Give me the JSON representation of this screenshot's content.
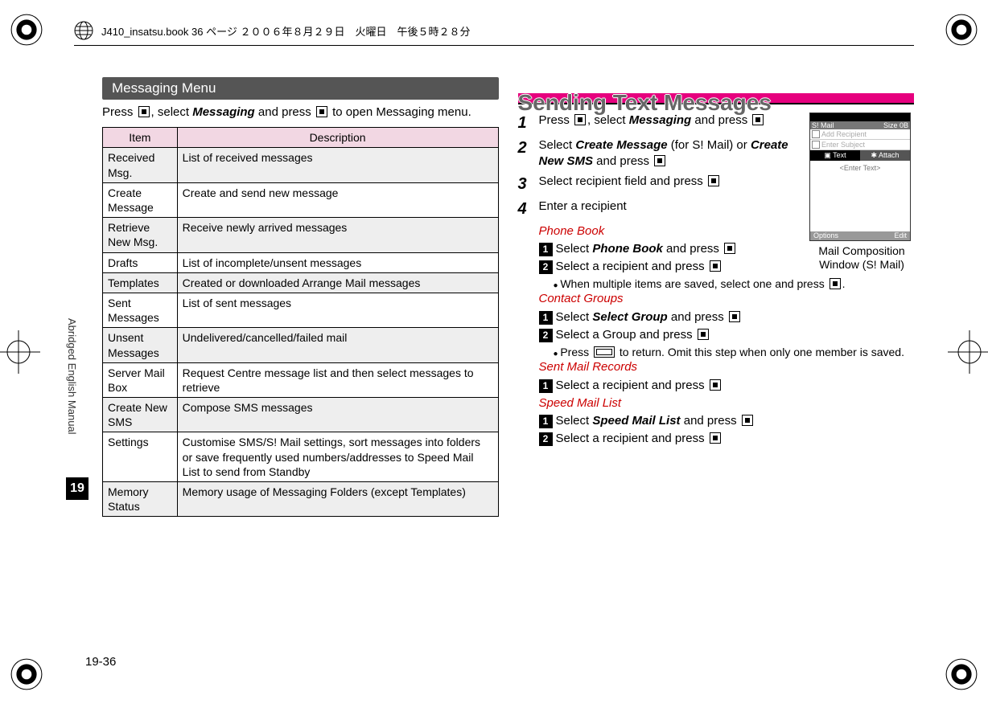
{
  "header_ts": "J410_insatsu.book 36 ページ ２００６年８月２９日　火曜日　午後５時２８分",
  "side_tab": "Abridged English Manual",
  "chapter": "19",
  "page_num": "19-36",
  "left": {
    "section_title": "Messaging Menu",
    "intro_a": "Press ",
    "intro_b": ", select ",
    "intro_term": "Messaging",
    "intro_c": " and press ",
    "intro_d": " to open Messaging menu.",
    "table": {
      "h1": "Item",
      "h2": "Description",
      "rows": [
        {
          "i": "Received Msg.",
          "d": "List of received messages"
        },
        {
          "i": "Create Message",
          "d": "Create and send new message"
        },
        {
          "i": "Retrieve New Msg.",
          "d": "Receive newly arrived messages"
        },
        {
          "i": "Drafts",
          "d": "List of incomplete/unsent messages"
        },
        {
          "i": "Templates",
          "d": "Created or downloaded Arrange Mail messages"
        },
        {
          "i": "Sent Messages",
          "d": "List of sent messages"
        },
        {
          "i": "Unsent Messages",
          "d": "Undelivered/cancelled/failed mail"
        },
        {
          "i": "Server Mail Box",
          "d": "Request Centre message list and then select messages to retrieve"
        },
        {
          "i": "Create New SMS",
          "d": "Compose SMS messages"
        },
        {
          "i": "Settings",
          "d": "Customise SMS/S! Mail settings, sort messages into folders or save frequently used numbers/addresses to Speed Mail List to send from Standby"
        },
        {
          "i": "Memory Status",
          "d": "Memory usage of Messaging Folders (except Templates)"
        }
      ]
    }
  },
  "right": {
    "headline": "Sending Text Messages",
    "phone": {
      "title_l": "S! Mail",
      "title_r": "Size 0B",
      "row1": "Add Recipient",
      "row2": "Enter Subject",
      "tab1": "Text",
      "tab2": "Attach",
      "body": "<Enter Text>",
      "soft_l": "Options",
      "soft_r": "Edit",
      "caption": "Mail Composition Window (S! Mail)"
    },
    "s1a": "Press ",
    "s1b": ", select ",
    "s1t": "Messaging",
    "s1c": " and press ",
    "s2a": "Select ",
    "s2t1": "Create Message",
    "s2b": " (for S! Mail) or ",
    "s2t2": "Create New SMS",
    "s2c": " and press ",
    "s3": "Select recipient field and press ",
    "s4": "Enter a recipient",
    "pb_title": "Phone Book",
    "pb1a": "Select ",
    "pb1t": "Phone Book",
    "pb1b": " and press ",
    "pb2": "Select a recipient and press ",
    "pb2n": "When multiple items are saved, select one and press ",
    "cg_title": "Contact Groups",
    "cg1a": "Select ",
    "cg1t": "Select Group",
    "cg1b": " and press ",
    "cg2": "Select a Group and press ",
    "cg2n": "Press ",
    "cg2n2": " to return. Omit this step when only one member is saved.",
    "sm_title": "Sent Mail Records",
    "sm1": "Select a recipient and press ",
    "sp_title": "Speed Mail List",
    "sp1a": "Select ",
    "sp1t": "Speed Mail List",
    "sp1b": " and press ",
    "sp2": "Select a recipient and press "
  }
}
